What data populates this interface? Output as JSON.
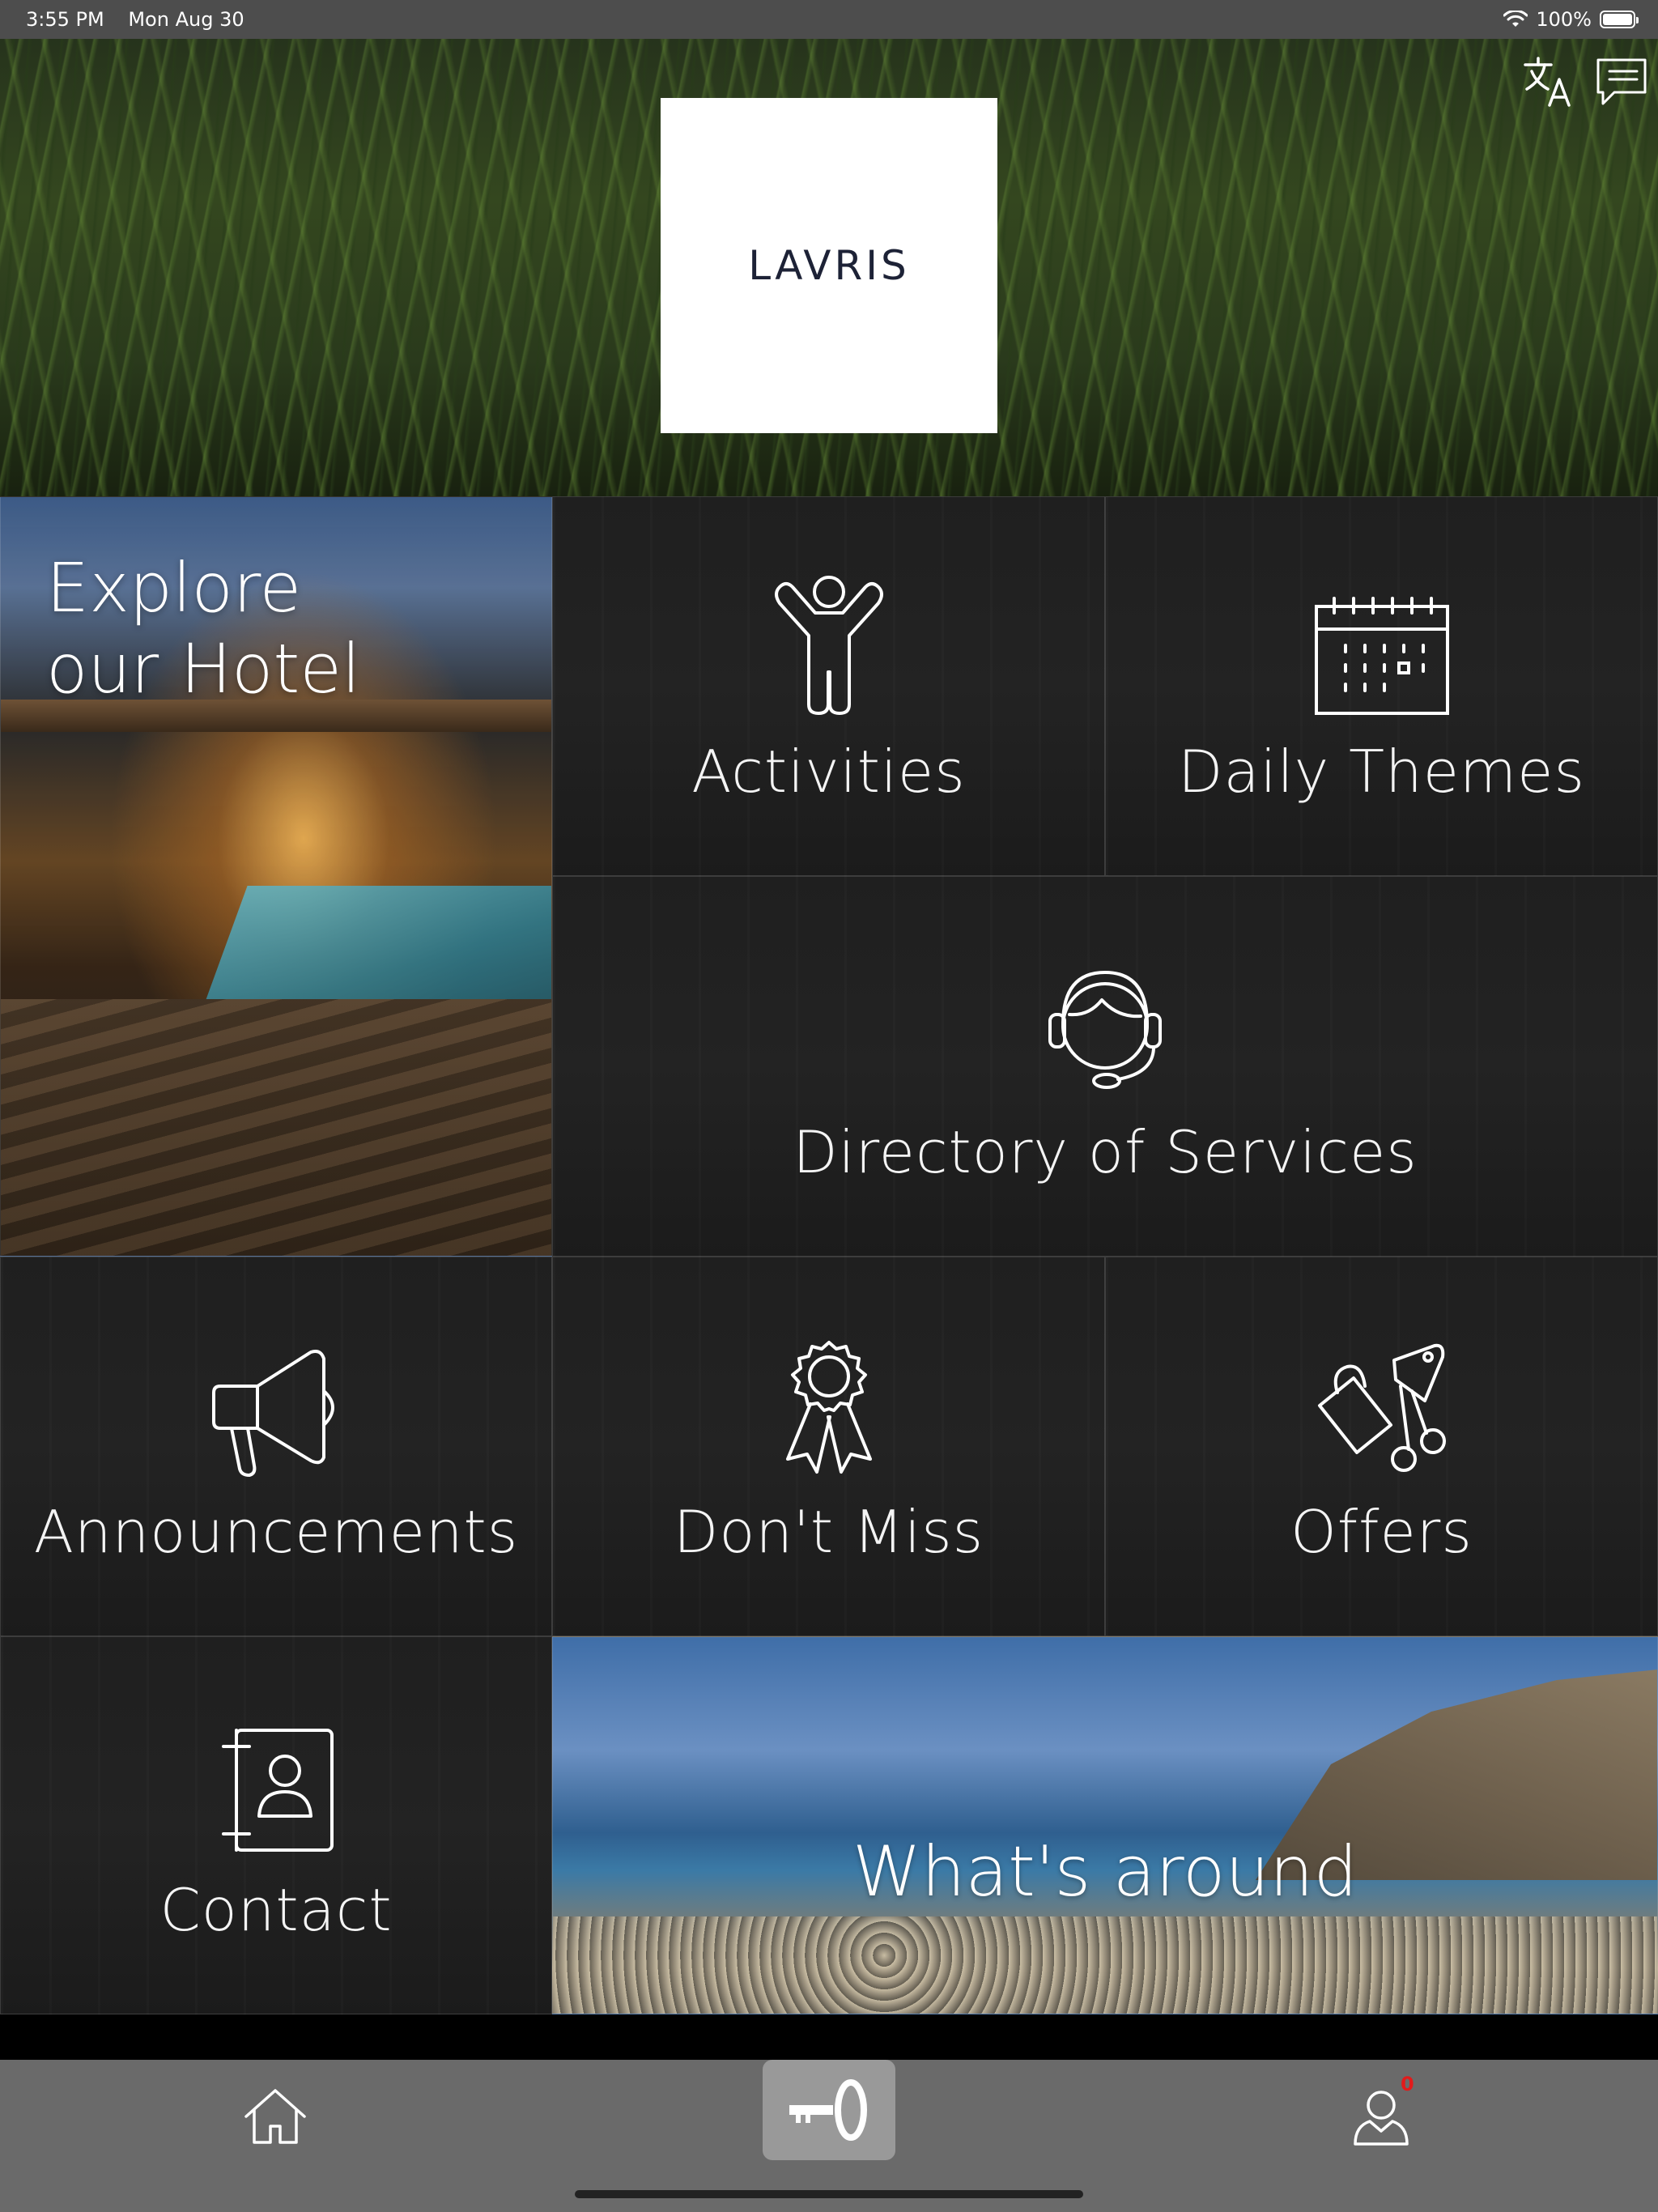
{
  "status_bar": {
    "time": "3:55 PM",
    "date": "Mon Aug 30",
    "battery": "100%"
  },
  "header": {
    "logo_text": "LAVRIS",
    "icons": [
      "translate-icon",
      "chat-icon"
    ]
  },
  "tiles": {
    "explore": {
      "title": "Explore our Hotel"
    },
    "activities": {
      "label": "Activities",
      "icon": "person-arms-up-icon"
    },
    "daily_themes": {
      "label": "Daily Themes",
      "icon": "calendar-icon"
    },
    "directory": {
      "label": "Directory of Services",
      "icon": "headset-agent-icon"
    },
    "announcements": {
      "label": "Announcements",
      "icon": "megaphone-icon"
    },
    "dont_miss": {
      "label": "Don't Miss",
      "icon": "award-ribbon-icon"
    },
    "offers": {
      "label": "Offers",
      "icon": "shopping-bag-tag-icon"
    },
    "contact": {
      "label": "Contact",
      "icon": "contact-book-icon"
    },
    "whats_around": {
      "label": "What's around"
    }
  },
  "tab_bar": {
    "items": [
      "home-icon",
      "key-icon",
      "profile-icon"
    ],
    "profile_badge": "0"
  },
  "colors": {
    "status_bar": "#4d4d4d",
    "tile_bg": "#1f1f1f",
    "tab_bar": "#6a6a6a",
    "key_button": "#999999",
    "badge": "#e21b1b"
  }
}
